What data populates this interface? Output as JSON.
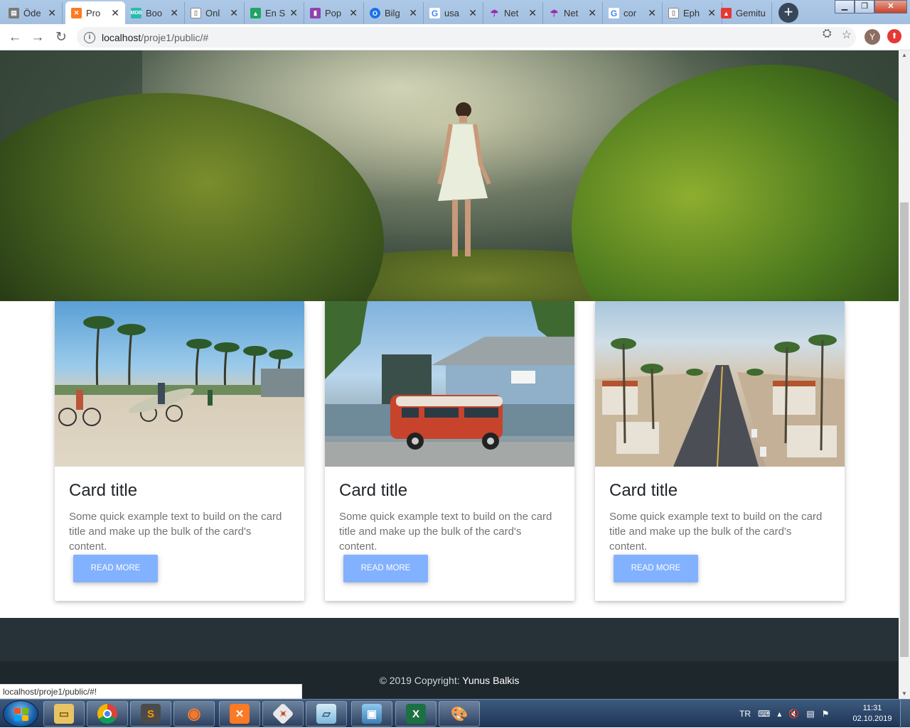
{
  "browser": {
    "tabs": [
      {
        "label": "Öde",
        "favicon": "page-icon",
        "color": "#7a7a7a",
        "active": false
      },
      {
        "label": "Pro",
        "favicon": "xampp-icon",
        "color": "#fb7a24",
        "active": true
      },
      {
        "label": "Boo",
        "favicon": "mdb-icon",
        "color": "#2bbbad",
        "active": false
      },
      {
        "label": "Onl",
        "favicon": "document-icon",
        "color": "#9aa0a6",
        "active": false
      },
      {
        "label": "En S",
        "favicon": "drive-icon",
        "color": "#1fa463",
        "active": false
      },
      {
        "label": "Pop",
        "favicon": "bookmark-icon",
        "color": "#8e44ad",
        "active": false
      },
      {
        "label": "Bilg",
        "favicon": "circle-icon",
        "color": "#1a73e8",
        "active": false
      },
      {
        "label": "usa",
        "favicon": "google-icon",
        "color": "#4285f4",
        "active": false
      },
      {
        "label": "Net",
        "favicon": "umbrella-icon",
        "color": "#9c27b0",
        "active": false
      },
      {
        "label": "Net",
        "favicon": "umbrella-icon",
        "color": "#9c27b0",
        "active": false
      },
      {
        "label": "cor",
        "favicon": "google-icon",
        "color": "#4285f4",
        "active": false
      },
      {
        "label": "Eph",
        "favicon": "document-icon",
        "color": "#9aa0a6",
        "active": false
      },
      {
        "label": "Gemitu",
        "favicon": "gemitu-icon",
        "color": "#e53935",
        "active": false
      }
    ],
    "address": {
      "host": "localhost",
      "path": "/proje1/public/#"
    },
    "avatar_letter": "Y",
    "status_url": "localhost/proje1/public/#!"
  },
  "cards": [
    {
      "image": "beach-cyclists-palms",
      "title": "Card title",
      "text": "Some quick example text to build on the card title and make up the bulk of the card's content.",
      "button": "Read more"
    },
    {
      "image": "red-van-blue-house",
      "title": "Card title",
      "text": "Some quick example text to build on the card title and make up the bulk of the card's content.",
      "button": "Read more"
    },
    {
      "image": "palm-street-aerial",
      "title": "Card title",
      "text": "Some quick example text to build on the card title and make up the bulk of the card's content.",
      "button": "Read more"
    }
  ],
  "footer": {
    "copyright_prefix": "© 2019 Copyright:",
    "copyright_name": "Yunus Balkis"
  },
  "taskbar": {
    "apps": [
      "explorer-icon",
      "chrome-icon",
      "sublime-icon",
      "blender-icon",
      "xampp-icon",
      "git-icon",
      "notepad-icon",
      "photos-icon",
      "excel-icon",
      "paint-icon"
    ],
    "language": "TR",
    "time": "11:31",
    "date": "02.10.2019"
  },
  "colors": {
    "button": "#82b1ff",
    "footer": "#263238",
    "footer_copyright": "#1e272c"
  }
}
